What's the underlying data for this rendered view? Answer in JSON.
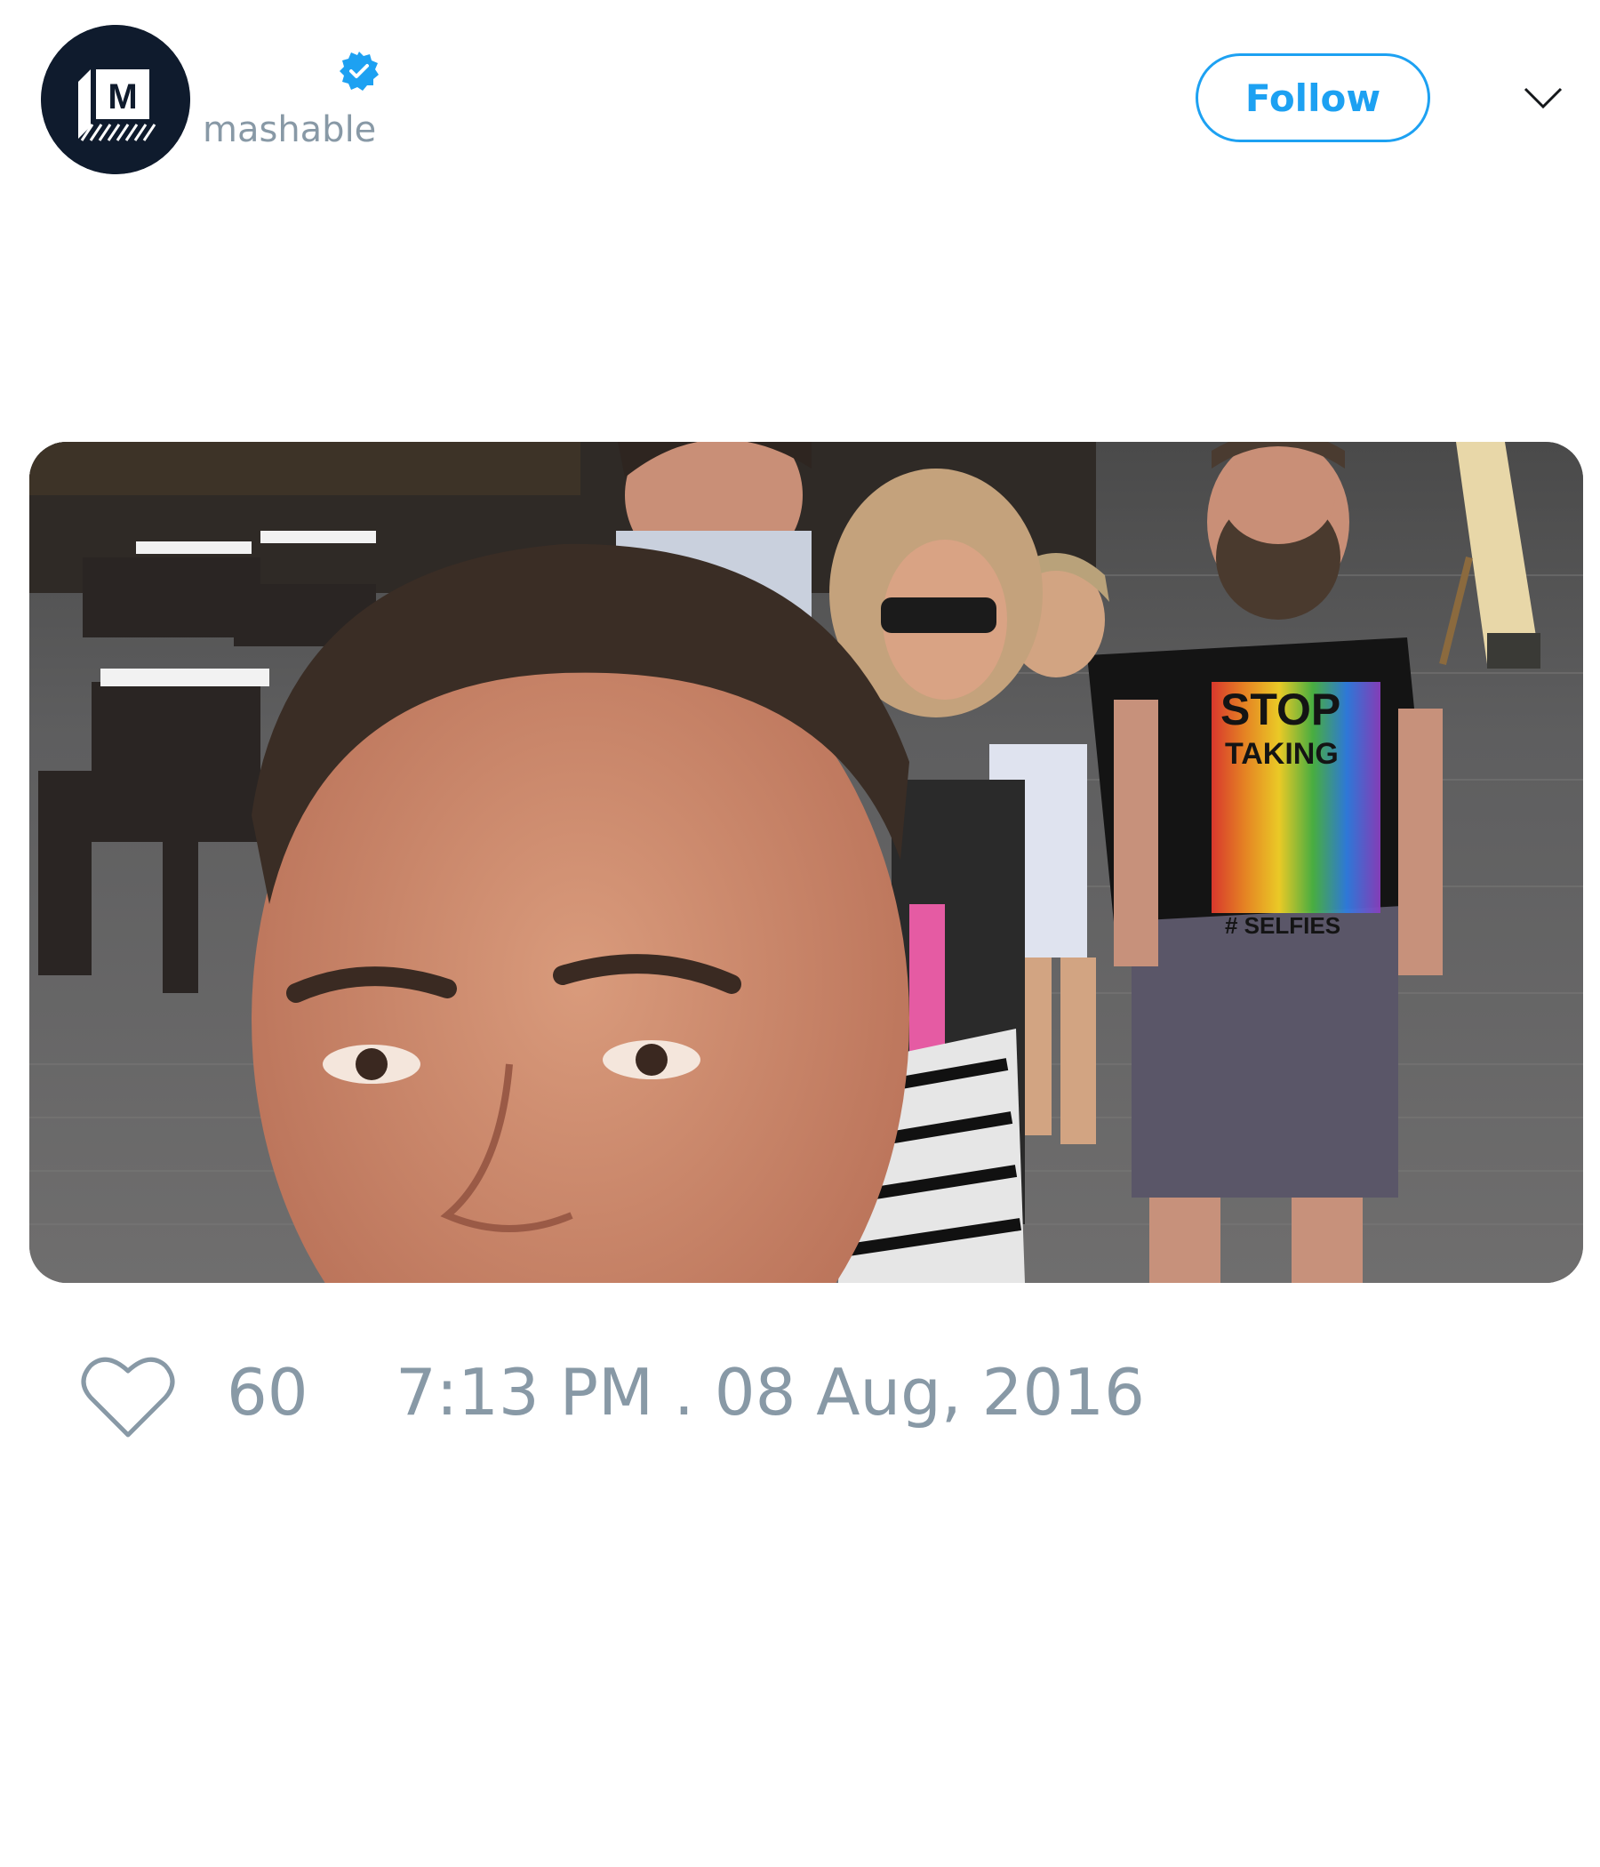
{
  "tweet": {
    "handle": "mashable",
    "avatar_letter": "M",
    "follow_label": "Follow",
    "like_count": "60",
    "timestamp": "7:13 PM . 08 Aug, 2016",
    "photo_shirt_text": {
      "line1": "STOP",
      "line2": "TAKING",
      "line3": "# SELFIES"
    }
  },
  "colors": {
    "accent": "#1da1f2",
    "muted_text": "#8899a6",
    "avatar_bg": "#0f1b2d"
  },
  "icons": [
    "verified-badge-icon",
    "chevron-down-icon",
    "heart-icon"
  ]
}
